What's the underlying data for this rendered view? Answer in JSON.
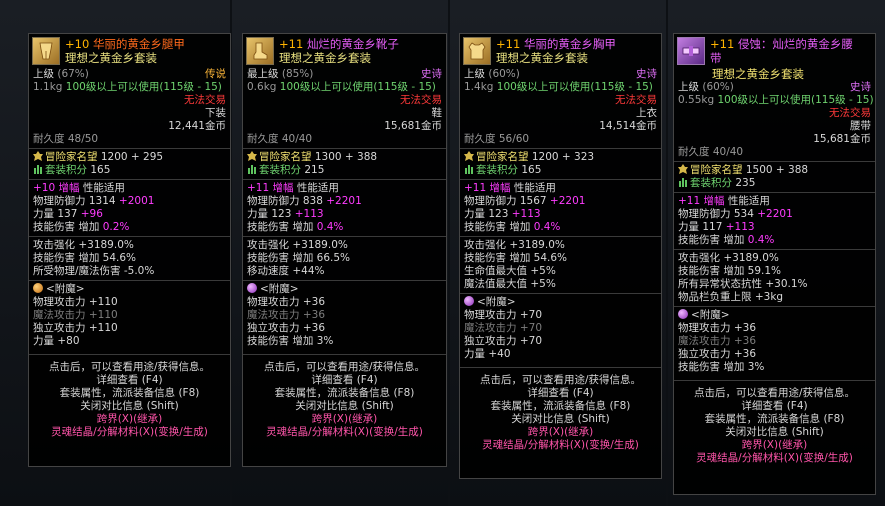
{
  "common": {
    "title_sep": ":",
    "durability_label": "耐久度",
    "fame_label": "冒险家名望",
    "set_points_label": "套装积分",
    "boost_label": "增幅",
    "boost_suffix": "性能适用",
    "atk_strength_label": "攻击强化",
    "skill_dmg_label": "技能伤害 增加",
    "enchant_label": "<附魔>",
    "phys_atk_label": "物理攻击力",
    "mag_atk_label": "魔法攻击力",
    "indep_atk_label": "独立攻击力",
    "strength_label": "力量",
    "foot1": "点击后，可以查看用途/获得信息。",
    "foot2": "详细查看 (F4)",
    "foot3": "套装属性，流派装备信息 (F8)",
    "foot4": "关闭对比信息 (Shift)",
    "foot5": "跨界(X)(继承)",
    "foot6": "灵魂结晶/分解材料(X)(变换/生成)"
  },
  "items": [
    {
      "level": "+10",
      "name": "华丽的黄金乡腿甲",
      "set_name": "理想之黄金乡套装",
      "grade": "上级",
      "grade_pct": "(67%)",
      "rarity": "传说",
      "weight": "1.1kg",
      "use_req": "100级以上可以使用(115级 - 15)",
      "trade": "无法交易",
      "slot": "下装",
      "price": "12,441金币",
      "durability": "48/50",
      "fame": "1200 + 295",
      "set_points": "165",
      "boost_level": "+10",
      "stat1_label": "物理防御力",
      "stat1_value": "1314",
      "stat1_bonus": "+2001",
      "str_value": "137",
      "str_bonus": "+96",
      "skill_boost": "0.2%",
      "opt1": "攻击强化 +3189.0%",
      "opt2": "技能伤害 增加 54.6%",
      "opt3": "所受物理/魔法伤害 -5.0%",
      "ench1": "+110",
      "ench2": "+110",
      "ench3": "+110",
      "ench4": "+80"
    },
    {
      "level": "+11",
      "name": "灿烂的黄金乡靴子",
      "set_name": "理想之黄金乡套装",
      "grade": "最上级",
      "grade_pct": "(85%)",
      "rarity": "史诗",
      "weight": "0.6kg",
      "use_req": "100级以上可以使用(115级 - 15)",
      "trade": "无法交易",
      "slot": "鞋",
      "price": "15,681金币",
      "durability": "40/40",
      "fame": "1300 + 388",
      "set_points": "215",
      "boost_level": "+11",
      "stat1_label": "物理防御力",
      "stat1_value": "838",
      "stat1_bonus": "+2201",
      "str_value": "123",
      "str_bonus": "+113",
      "skill_boost": "0.4%",
      "opt1": "攻击强化 +3189.0%",
      "opt2": "技能伤害 增加 66.5%",
      "opt3": "移动速度 +44%",
      "ench1": "+36",
      "ench2": "+36",
      "ench3": "+36",
      "ench4": "3%"
    },
    {
      "level": "+11",
      "name": "华丽的黄金乡胸甲",
      "set_name": "理想之黄金乡套装",
      "grade": "上级",
      "grade_pct": "(60%)",
      "rarity": "史诗",
      "weight": "1.4kg",
      "use_req": "100级以上可以使用(115级 - 15)",
      "trade": "无法交易",
      "slot": "上衣",
      "price": "14,514金币",
      "durability": "56/60",
      "fame": "1200 + 323",
      "set_points": "165",
      "boost_level": "+11",
      "stat1_label": "物理防御力",
      "stat1_value": "1567",
      "stat1_bonus": "+2201",
      "str_value": "123",
      "str_bonus": "+113",
      "skill_boost": "0.4%",
      "opt1": "攻击强化 +3189.0%",
      "opt2": "技能伤害 增加 54.6%",
      "opt3": "生命值最大值 +5%",
      "opt4": "魔法值最大值 +5%",
      "ench1": "+70",
      "ench2": "+70",
      "ench3": "+70",
      "ench4": "+40"
    },
    {
      "level": "+11",
      "name": "侵蚀：灿烂的黄金乡腰带",
      "name_line1": "侵蚀：灿烂的黄金乡腰",
      "name_line2": "带",
      "set_name": "理想之黄金乡套装",
      "grade": "上级",
      "grade_pct": "(60%)",
      "rarity": "史诗",
      "weight": "0.55kg",
      "use_req": "100级以上可以使用(115级 - 15)",
      "trade": "无法交易",
      "slot": "腰带",
      "price": "15,681金币",
      "durability": "40/40",
      "fame": "1500 + 388",
      "set_points": "235",
      "boost_level": "+11",
      "stat1_label": "物理防御力",
      "stat1_value": "534",
      "stat1_bonus": "+2201",
      "str_value": "117",
      "str_bonus": "+113",
      "skill_boost": "0.4%",
      "opt1": "攻击强化 +3189.0%",
      "opt2": "技能伤害 增加 59.1%",
      "opt3": "所有异常状态抗性 +30.1%",
      "opt4": "物品栏负重上限 +3kg",
      "ench1": "+36",
      "ench2": "+36",
      "ench3": "+36",
      "ench4": "3%"
    }
  ]
}
